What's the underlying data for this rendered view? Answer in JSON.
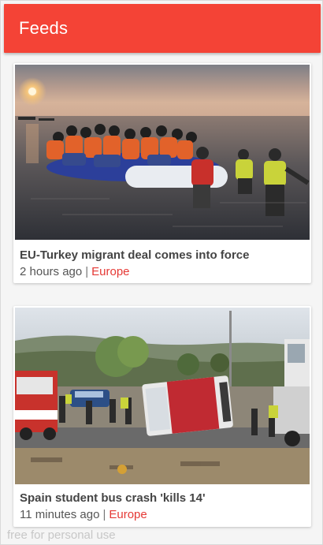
{
  "app_bar": {
    "title": "Feeds",
    "color": "#f44336"
  },
  "feeds": [
    {
      "title": "EU-Turkey migrant deal comes into force",
      "time": "2 hours ago",
      "separator": "|",
      "category": "Europe"
    },
    {
      "title": "Spain student bus crash 'kills 14'",
      "time": "11 minutes ago",
      "separator": "|",
      "category": "Europe"
    }
  ],
  "watermark": "free for personal use",
  "colors": {
    "accent": "#f44336",
    "category": "#e53935",
    "background": "#f5f5f5"
  }
}
